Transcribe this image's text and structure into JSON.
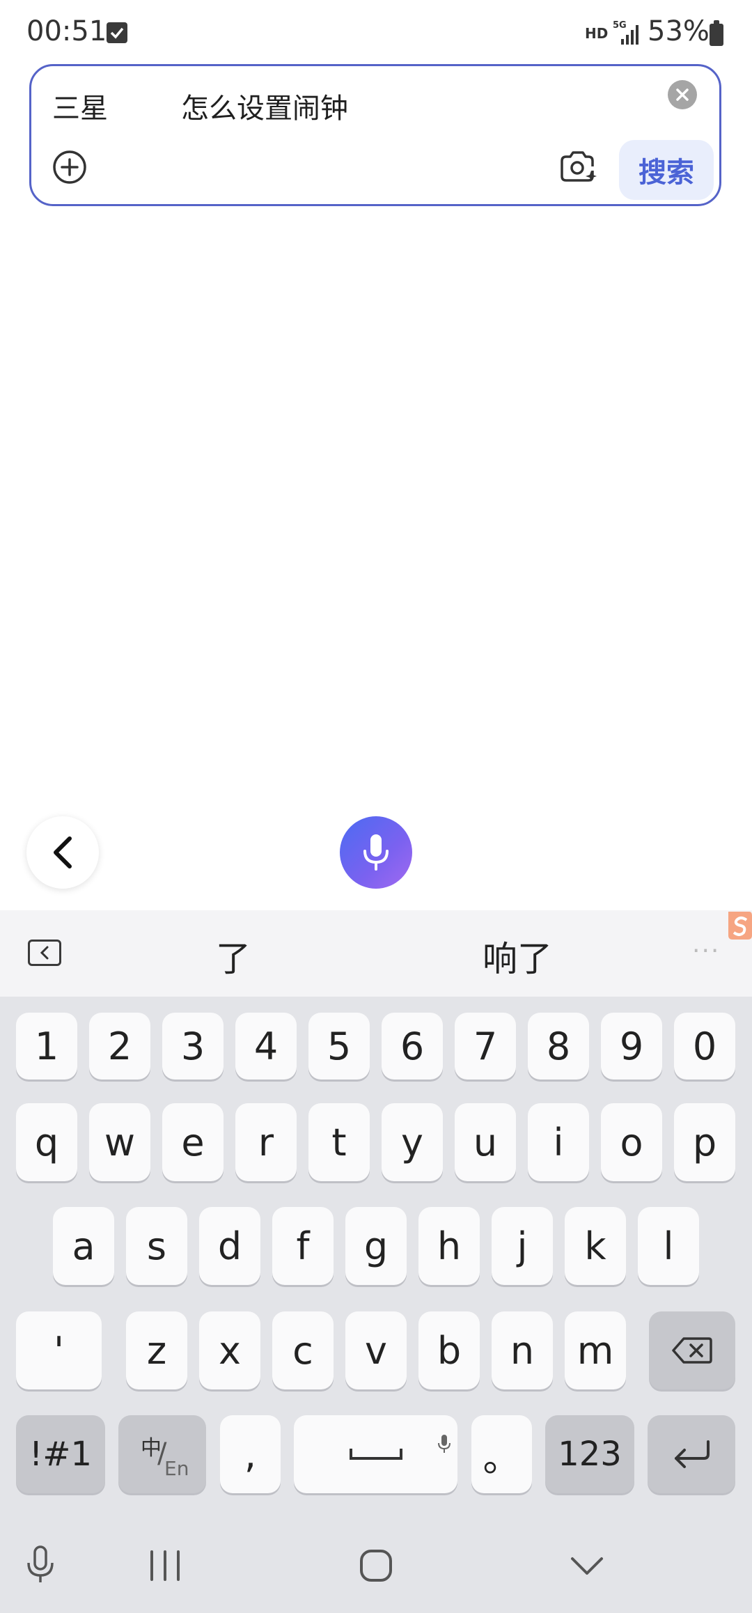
{
  "status": {
    "time": "00:51",
    "hd": "HD",
    "network": "5G",
    "battery": "53%"
  },
  "search": {
    "query_prefix": "三星",
    "query_text": "怎么设置闹钟",
    "search_button": "搜索"
  },
  "keyboard": {
    "candidates": [
      "了",
      "响了"
    ],
    "more": "···",
    "number_row": [
      "1",
      "2",
      "3",
      "4",
      "5",
      "6",
      "7",
      "8",
      "9",
      "0"
    ],
    "row1": [
      "q",
      "w",
      "e",
      "r",
      "t",
      "y",
      "u",
      "i",
      "o",
      "p"
    ],
    "row2": [
      "a",
      "s",
      "d",
      "f",
      "g",
      "h",
      "j",
      "k",
      "l"
    ],
    "row3_first": "'",
    "row3": [
      "z",
      "x",
      "c",
      "v",
      "b",
      "n",
      "m"
    ],
    "symbols_key": "!#1",
    "lang_key_top": "中",
    "lang_key_bottom": "En",
    "comma_key": ",",
    "period_key": "。",
    "num_key": "123"
  }
}
